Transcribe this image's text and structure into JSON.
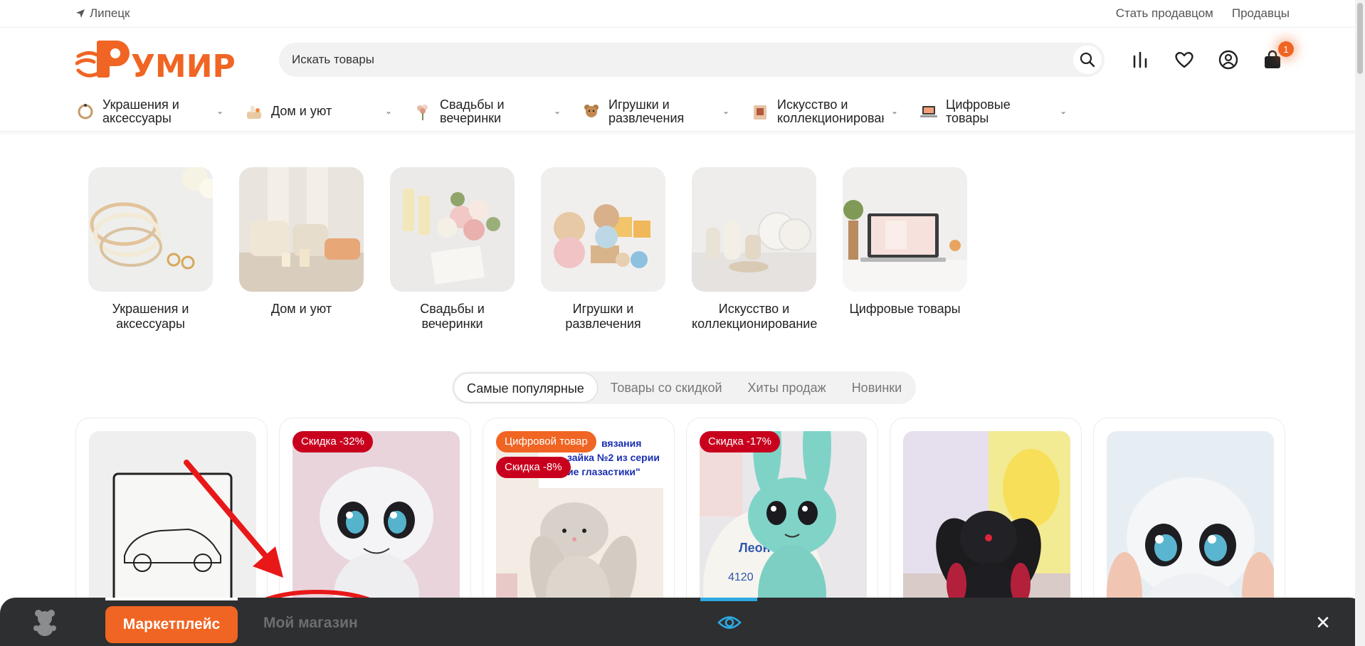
{
  "topbar": {
    "location": "Липецк",
    "become_seller": "Стать продавцом",
    "sellers": "Продавцы"
  },
  "header": {
    "logo_text": "РУМИР",
    "brand_color": "#f06523",
    "search_placeholder": "Искать товары",
    "cart_count": "1",
    "icons": [
      "compare-icon",
      "heart-icon",
      "user-icon",
      "bag-icon"
    ]
  },
  "categories": [
    {
      "label": "Украшения и\nаксессуары",
      "icon": "jewelry-icon"
    },
    {
      "label": "Дом и уют",
      "icon": "home-icon"
    },
    {
      "label": "Свадьбы и\nвечеринки",
      "icon": "wedding-icon"
    },
    {
      "label": "Игрушки и\nразвлечения",
      "icon": "toy-icon"
    },
    {
      "label": "Искусство и\nколлекционирование",
      "icon": "art-icon"
    },
    {
      "label": "Цифровые\nтовары",
      "icon": "laptop-icon"
    }
  ],
  "tiles": [
    {
      "label": "Украшения и\nаксессуары"
    },
    {
      "label": "Дом и уют"
    },
    {
      "label": "Свадьбы и\nвечеринки"
    },
    {
      "label": "Игрушки и\nразвлечения"
    },
    {
      "label": "Искусство и\nколлекционирование"
    },
    {
      "label": "Цифровые товары"
    }
  ],
  "tabs": [
    "Самые популярные",
    "Товары со скидкой",
    "Хиты продаж",
    "Новинки"
  ],
  "products": [
    {
      "labels": []
    },
    {
      "labels": [
        {
          "text": "Скидка -32%",
          "kind": "discount"
        }
      ]
    },
    {
      "labels": [
        {
          "text": "Цифровой товар",
          "kind": "digital"
        },
        {
          "text": "Скидка -8%",
          "kind": "discount"
        }
      ]
    },
    {
      "labels": [
        {
          "text": "Скидка -17%",
          "kind": "discount"
        }
      ]
    },
    {
      "labels": []
    },
    {
      "labels": []
    }
  ],
  "bottombar": {
    "marketplace": "Маркетплейс",
    "my_shop": "Мой магазин"
  }
}
